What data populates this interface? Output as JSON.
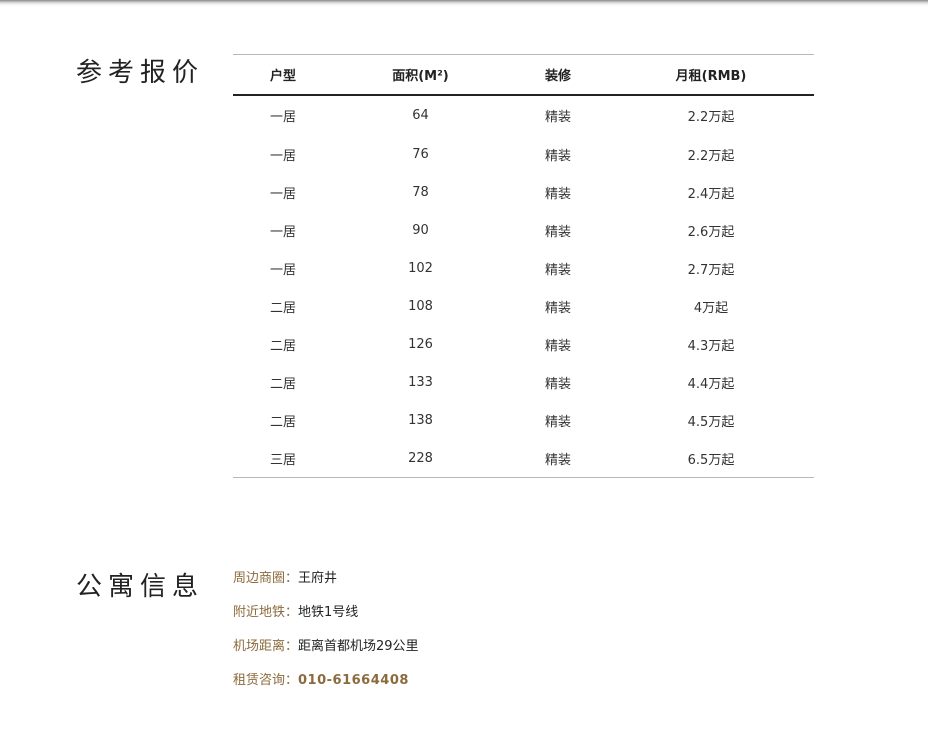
{
  "price_section": {
    "title": "参考报价",
    "columns": [
      "户型",
      "面积(M²)",
      "装修",
      "月租(RMB)"
    ],
    "rows": [
      [
        "一居",
        "64",
        "精装",
        "2.2万起"
      ],
      [
        "一居",
        "76",
        "精装",
        "2.2万起"
      ],
      [
        "一居",
        "78",
        "精装",
        "2.4万起"
      ],
      [
        "一居",
        "90",
        "精装",
        "2.6万起"
      ],
      [
        "一居",
        "102",
        "精装",
        "2.7万起"
      ],
      [
        "二居",
        "108",
        "精装",
        "4万起"
      ],
      [
        "二居",
        "126",
        "精装",
        "4.3万起"
      ],
      [
        "二居",
        "133",
        "精装",
        "4.4万起"
      ],
      [
        "二居",
        "138",
        "精装",
        "4.5万起"
      ],
      [
        "三居",
        "228",
        "精装",
        "6.5万起"
      ]
    ]
  },
  "info_section": {
    "title": "公寓信息",
    "items": [
      {
        "label": "周边商圈：",
        "value": "王府井"
      },
      {
        "label": "附近地铁：",
        "value": "地铁1号线"
      },
      {
        "label": "机场距离：",
        "value": "距离首都机场29公里"
      },
      {
        "label": "租赁咨询：",
        "value": "010-61664408"
      }
    ]
  },
  "colors": {
    "accent": "#8b6b3d",
    "text": "#222222",
    "rule": "#b8b8b8"
  }
}
